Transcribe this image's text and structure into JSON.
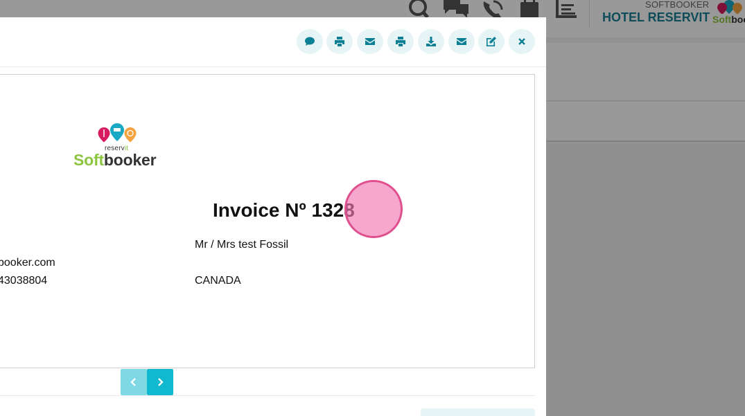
{
  "header": {
    "brand_sup": "SOFTBOOKER",
    "brand_name": "HOTEL RESERVIT",
    "mini_logo_green": "Soft",
    "mini_logo_dark": "booker",
    "icons": [
      "search-icon",
      "chat-icon",
      "phone-icon",
      "calendar-icon",
      "list-icon"
    ]
  },
  "toolbar": {
    "buttons": [
      "comment-icon",
      "print-icon",
      "email-icon",
      "print-icon",
      "download-icon",
      "email-icon",
      "edit-icon",
      "close-icon"
    ]
  },
  "invoice": {
    "logo": {
      "reservit_prefix": "reserv",
      "reservit_suffix": "it",
      "brand_green": "Soft",
      "brand_dark": "booker"
    },
    "title": "Invoice Nº 1328",
    "recipient_name": "Mr / Mrs test Fossil",
    "email_fragment": "booker.com",
    "phone_fragment": "43038804",
    "country": "CANADA"
  },
  "colors": {
    "accent": "#10b8d0",
    "accent_light": "#7fd9e4",
    "icon_color": "#0b7f94",
    "icon_bg": "#e6f4f5",
    "brand_green": "#8cc63f",
    "brand_teal": "#1a7f95"
  }
}
